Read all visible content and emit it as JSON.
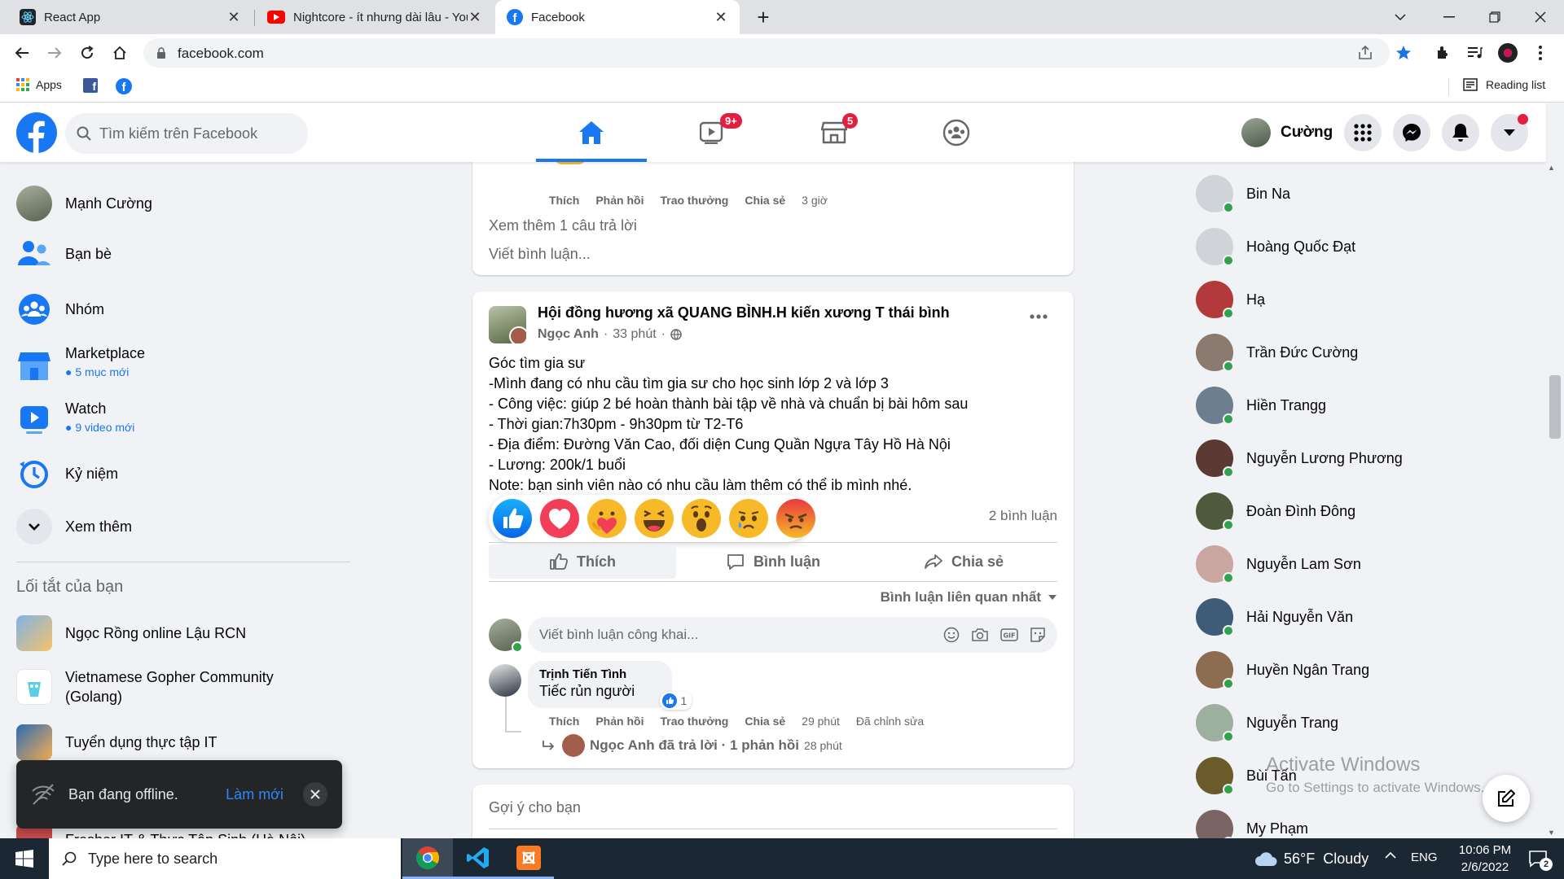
{
  "browser": {
    "tabs": [
      {
        "title": "React App",
        "icon": "react-icon"
      },
      {
        "title": "Nightcore - ít nhưng dài lâu - You",
        "icon": "youtube-icon"
      },
      {
        "title": "Facebook",
        "icon": "facebook-icon",
        "active": true
      }
    ],
    "new_tab": "+",
    "url": "facebook.com",
    "bookmarks": {
      "apps": "Apps",
      "reading_list": "Reading list"
    }
  },
  "header": {
    "search_placeholder": "Tìm kiếm trên Facebook",
    "watch_badge": "9+",
    "market_badge": "5",
    "profile_name": "Cường"
  },
  "left_sidebar": {
    "profile": "Mạnh Cường",
    "items": [
      {
        "label": "Bạn bè"
      },
      {
        "label": "Nhóm"
      },
      {
        "label": "Marketplace",
        "sub": "5 mục mới"
      },
      {
        "label": "Watch",
        "sub": "9 video mới"
      },
      {
        "label": "Kỷ niệm"
      },
      {
        "label": "Xem thêm"
      }
    ],
    "shortcuts_title": "Lối tắt của bạn",
    "shortcuts": [
      {
        "label": "Ngọc Rồng online Lậu RCN"
      },
      {
        "label": "Vietnamese Gopher Community (Golang)"
      },
      {
        "label": "Tuyển dụng thực tập IT"
      },
      {
        "label": "Fresher IT & Thực Tập Sinh (Hà Nội)"
      }
    ]
  },
  "offline_toast": {
    "text": "Bạn đang offline.",
    "action": "Làm mới"
  },
  "prev_post": {
    "actions": {
      "like": "Thích",
      "reply": "Phản hồi",
      "reward": "Trao thưởng",
      "share": "Chia sẻ",
      "time": "3 giờ"
    },
    "more_replies": "Xem thêm 1 câu trả lời",
    "write_comment": "Viết bình luận..."
  },
  "post": {
    "group": "Hội đồng hương xã QUANG BÌNH.H kiến xương T thái bình",
    "author": "Ngọc Anh",
    "time": "33 phút",
    "lines": [
      "Góc tìm gia sư",
      "-Mình đang có nhu cầu tìm gia sư cho học sinh lớp 2 và lớp 3",
      "- Công việc: giúp 2 bé hoàn thành bài tập về nhà và chuẩn bị bài hôm sau",
      "- Thời gian:7h30pm - 9h30pm từ T2-T6",
      "- Địa điểm: Đường Văn Cao, đối diện Cung Quần Ngựa Tây Hồ Hà Nội",
      "- Lương: 200k/1 buổi",
      "Note: bạn sinh viên nào có nhu cầu làm thêm có thể ib mình nhé."
    ],
    "comment_count": "2 bình luận",
    "reactions": [
      "like-reaction-icon",
      "love-reaction-icon",
      "care-reaction-icon",
      "haha-reaction-icon",
      "wow-reaction-icon",
      "sad-reaction-icon",
      "angry-reaction-icon"
    ],
    "buttons": {
      "like": "Thích",
      "comment": "Bình luận",
      "share": "Chia sẻ"
    },
    "sort": "Bình luận liên quan nhất",
    "comment_placeholder": "Viết bình luận công khai...",
    "comment": {
      "author": "Trịnh Tiến Tình",
      "text": "Tiếc rủn người",
      "likes": "1",
      "actions": {
        "like": "Thích",
        "reply": "Phản hồi",
        "reward": "Trao thưởng",
        "share": "Chia sẻ",
        "time": "29 phút",
        "edited": "Đã chỉnh sửa"
      },
      "reply_summary": "Ngọc Anh đã trả lời · 1 phản hồi",
      "reply_time": "28 phút"
    }
  },
  "suggest": {
    "title": "Gợi ý cho bạn"
  },
  "contacts": [
    {
      "name": "Bin Na",
      "color": "#d0d3d8"
    },
    {
      "name": "Hoàng Quốc Đạt",
      "color": "#d0d3d8"
    },
    {
      "name": "Hạ",
      "color": "#b23a3a"
    },
    {
      "name": "Trần Đức Cường",
      "color": "#8a7a70"
    },
    {
      "name": "Hiền Trangg",
      "color": "#6d7f8e"
    },
    {
      "name": "Nguyễn Lương Phương",
      "color": "#5a3a32"
    },
    {
      "name": "Đoàn Đình Đông",
      "color": "#4f5a3c"
    },
    {
      "name": "Nguyễn Lam Sơn",
      "color": "#c9a7a0"
    },
    {
      "name": "Hải Nguyễn Văn",
      "color": "#3e5b78"
    },
    {
      "name": "Huyền Ngân Trang",
      "color": "#8c6d52"
    },
    {
      "name": "Nguyễn Trang",
      "color": "#9db0a0"
    },
    {
      "name": "Bùi Tấn",
      "color": "#6b5a2a"
    },
    {
      "name": "My Phạm",
      "color": "#7a6464"
    }
  ],
  "watermark": {
    "title": "Activate Windows",
    "sub": "Go to Settings to activate Windows."
  },
  "taskbar": {
    "search_placeholder": "Type here to search",
    "weather": "56°F  Cloudy",
    "lang": "ENG",
    "time": "10:06 PM",
    "date": "2/6/2022",
    "notifications": "2"
  }
}
